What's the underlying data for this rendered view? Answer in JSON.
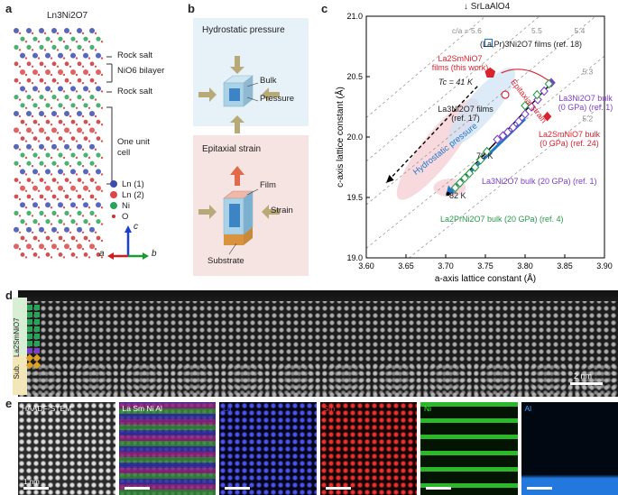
{
  "panels": {
    "a": {
      "label": "a",
      "title": "Ln3Ni2O7",
      "layers": {
        "rock_salt_top": "Rock salt",
        "bilayer": "NiO6 bilayer",
        "rock_salt_bottom": "Rock salt",
        "unit_cell": "One unit cell"
      },
      "legend": [
        {
          "label": "Ln (1)",
          "color": "#3b4bb0"
        },
        {
          "label": "Ln (2)",
          "color": "#d94848"
        },
        {
          "label": "Ni",
          "color": "#2aa35a"
        },
        {
          "label": "O",
          "color": "#c83232"
        }
      ],
      "axes": {
        "c": "c",
        "a": "a",
        "b": "b"
      }
    },
    "b": {
      "label": "b",
      "hydro_title": "Hydrostatic pressure",
      "hydro_bulk": "Bulk",
      "hydro_pressure": "Pressure",
      "epi_title": "Epitaxial strain",
      "epi_film": "Film",
      "epi_strain": "Strain",
      "epi_substrate": "Substrate"
    },
    "c": {
      "label": "c",
      "top_marker": "SrLaAlO4",
      "annotations": {
        "lapr_films": "(La,Pr)3Ni2O7 films (ref. 18)",
        "lasmnio_films_1": "La2SmNiO7",
        "lasmnio_films_2": "films (this work)",
        "tc": "Tc = 41 K",
        "epitaxial_strain": "Epitaxial strain",
        "lanio_films_1": "La3Ni2O7 films",
        "lanio_films_2": "(ref. 17)",
        "hydro_pressure": "Hydrostatic pressure",
        "lanio_bulk_1": "La3Ni2O7 bulk",
        "lanio_bulk_2": "(0 GPa) (ref. 1)",
        "lasmnio_bulk_1": "La2SmNiO7 bulk",
        "lasmnio_bulk_2": "(0 GPa) (ref. 24)",
        "k78": "78 K",
        "lanio_20gpa": "La3Ni2O7 bulk (20 GPa) (ref. 1)",
        "k82": "82 K",
        "laprnio_20gpa": "La2PrNi2O7 bulk (20 GPa) (ref. 4)"
      },
      "ca_labels": [
        "c/a = 5.6",
        "5.5",
        "5.4",
        "5.3",
        "5.2"
      ],
      "colors": {
        "red": "#d9232e",
        "purple": "#7a3fc4",
        "green": "#2a9a48",
        "blue": "#1f77c8"
      }
    },
    "d": {
      "label": "d",
      "side_label": "La2SmNiO7",
      "sub_label": "Sub.",
      "scale_bar": "2 nm"
    },
    "e": {
      "label": "e",
      "tiles": [
        {
          "title": "HAADF-STEM",
          "color": "#ffffff"
        },
        {
          "title": "La Sm Ni Al",
          "color": "#ffffff"
        },
        {
          "title": "La",
          "color": "#3b4bff"
        },
        {
          "title": "Sm",
          "color": "#ff3030"
        },
        {
          "title": "Ni",
          "color": "#30ff30"
        },
        {
          "title": "Al",
          "color": "#3aa8ff"
        }
      ],
      "scale_bar": "1 nm"
    }
  },
  "chart_data": {
    "type": "scatter",
    "title": "",
    "xlabel": "a-axis lattice constant (Å)",
    "ylabel": "c-axis lattice constant (Å)",
    "xlim": [
      3.6,
      3.9
    ],
    "ylim": [
      19.0,
      21.0
    ],
    "xticks": [
      "3.60",
      "3.65",
      "3.70",
      "3.75",
      "3.80",
      "3.85",
      "3.90"
    ],
    "yticks": [
      "19.0",
      "19.5",
      "20.0",
      "20.5",
      "21.0"
    ],
    "ca_ratios": [
      5.6,
      5.5,
      5.4,
      5.3,
      5.2
    ],
    "grid": false,
    "series": [
      {
        "name": "(La,Pr)3Ni2O7 films (ref. 18)",
        "color": "#1f77c8",
        "marker": "square-open",
        "points": [
          [
            3.754,
            20.78
          ]
        ]
      },
      {
        "name": "La2SmNiO7 films (this work)",
        "color": "#d9232e",
        "marker": "pentagon",
        "points": [
          [
            3.756,
            20.53
          ]
        ]
      },
      {
        "name": "La3Ni2O7 films (ref. 17)",
        "color": "#d9232e",
        "marker": "circle-open",
        "points": [
          [
            3.775,
            20.35
          ]
        ]
      },
      {
        "name": "La3Ni2O7 bulk (0 GPa) (ref. 1)",
        "color": "#7a3fc4",
        "marker": "diamond",
        "points": [
          [
            3.833,
            20.45
          ]
        ]
      },
      {
        "name": "La2SmNiO7 bulk (0 GPa) (ref. 24)",
        "color": "#d9232e",
        "marker": "diamond",
        "points": [
          [
            3.828,
            20.17
          ]
        ]
      },
      {
        "name": "La3Ni2O7 bulk (20 GPa) (ref. 1)",
        "color": "#7a3fc4",
        "marker": "diamond-open",
        "points": [
          [
            3.765,
            19.98
          ],
          [
            3.772,
            20.01
          ],
          [
            3.778,
            20.04
          ],
          [
            3.785,
            20.08
          ],
          [
            3.792,
            20.13
          ],
          [
            3.8,
            20.19
          ],
          [
            3.808,
            20.25
          ],
          [
            3.816,
            20.31
          ],
          [
            3.824,
            20.38
          ]
        ]
      },
      {
        "name": "La2PrNi2O7 bulk (20 GPa) (ref. 4)",
        "color": "#2a9a48",
        "marker": "diamond-open",
        "points": [
          [
            3.712,
            19.58
          ],
          [
            3.718,
            19.62
          ],
          [
            3.724,
            19.66
          ],
          [
            3.73,
            19.7
          ],
          [
            3.737,
            19.75
          ],
          [
            3.744,
            19.81
          ],
          [
            3.752,
            19.88
          ],
          [
            3.8,
            20.26
          ],
          [
            3.815,
            20.35
          ],
          [
            3.83,
            20.44
          ]
        ]
      }
    ]
  }
}
